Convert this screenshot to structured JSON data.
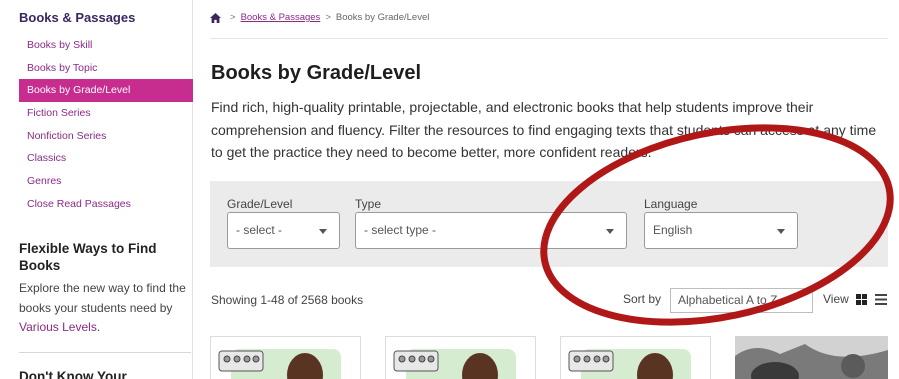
{
  "sidebar": {
    "heading": "Books & Passages",
    "items": [
      {
        "label": "Books by Skill",
        "active": false
      },
      {
        "label": "Books by Topic",
        "active": false
      },
      {
        "label": "Books by Grade/Level",
        "active": true
      },
      {
        "label": "Fiction Series",
        "active": false
      },
      {
        "label": "Nonfiction Series",
        "active": false
      },
      {
        "label": "Classics",
        "active": false
      },
      {
        "label": "Genres",
        "active": false
      },
      {
        "label": "Close Read Passages",
        "active": false
      }
    ],
    "flexible": {
      "title": "Flexible Ways to Find Books",
      "body_text": "Explore the new way to find the books your students need by ",
      "link_label": "Various Levels",
      "body_end": "."
    },
    "dont_know_title": "Don't Know Your"
  },
  "breadcrumb": {
    "home_icon": "home-icon",
    "separator": ">",
    "link": "Books & Passages",
    "current": "Books by Grade/Level"
  },
  "main": {
    "title": "Books by Grade/Level",
    "intro": "Find rich, high-quality printable, projectable, and electronic books that help students improve their comprehension and fluency. Filter the resources to find engaging texts that students can access at any time to get the practice they need to become better, more confident readers."
  },
  "filters": {
    "grade": {
      "label": "Grade/Level",
      "value": "- select -"
    },
    "type": {
      "label": "Type",
      "value": "- select type -"
    },
    "language": {
      "label": "Language",
      "value": "English"
    }
  },
  "results": {
    "count_text": "Showing 1-48 of 2568 books",
    "sort_label": "Sort by",
    "sort_value": "Alphabetical A to Z",
    "view_label": "View",
    "grid_icon": "grid-view-icon",
    "list_icon": "list-view-icon"
  },
  "colors": {
    "accent": "#c72d8e",
    "link": "#8b2a86",
    "heading": "#3c2660",
    "annotation": "#b01818",
    "filter_bg": "#ebebeb"
  }
}
